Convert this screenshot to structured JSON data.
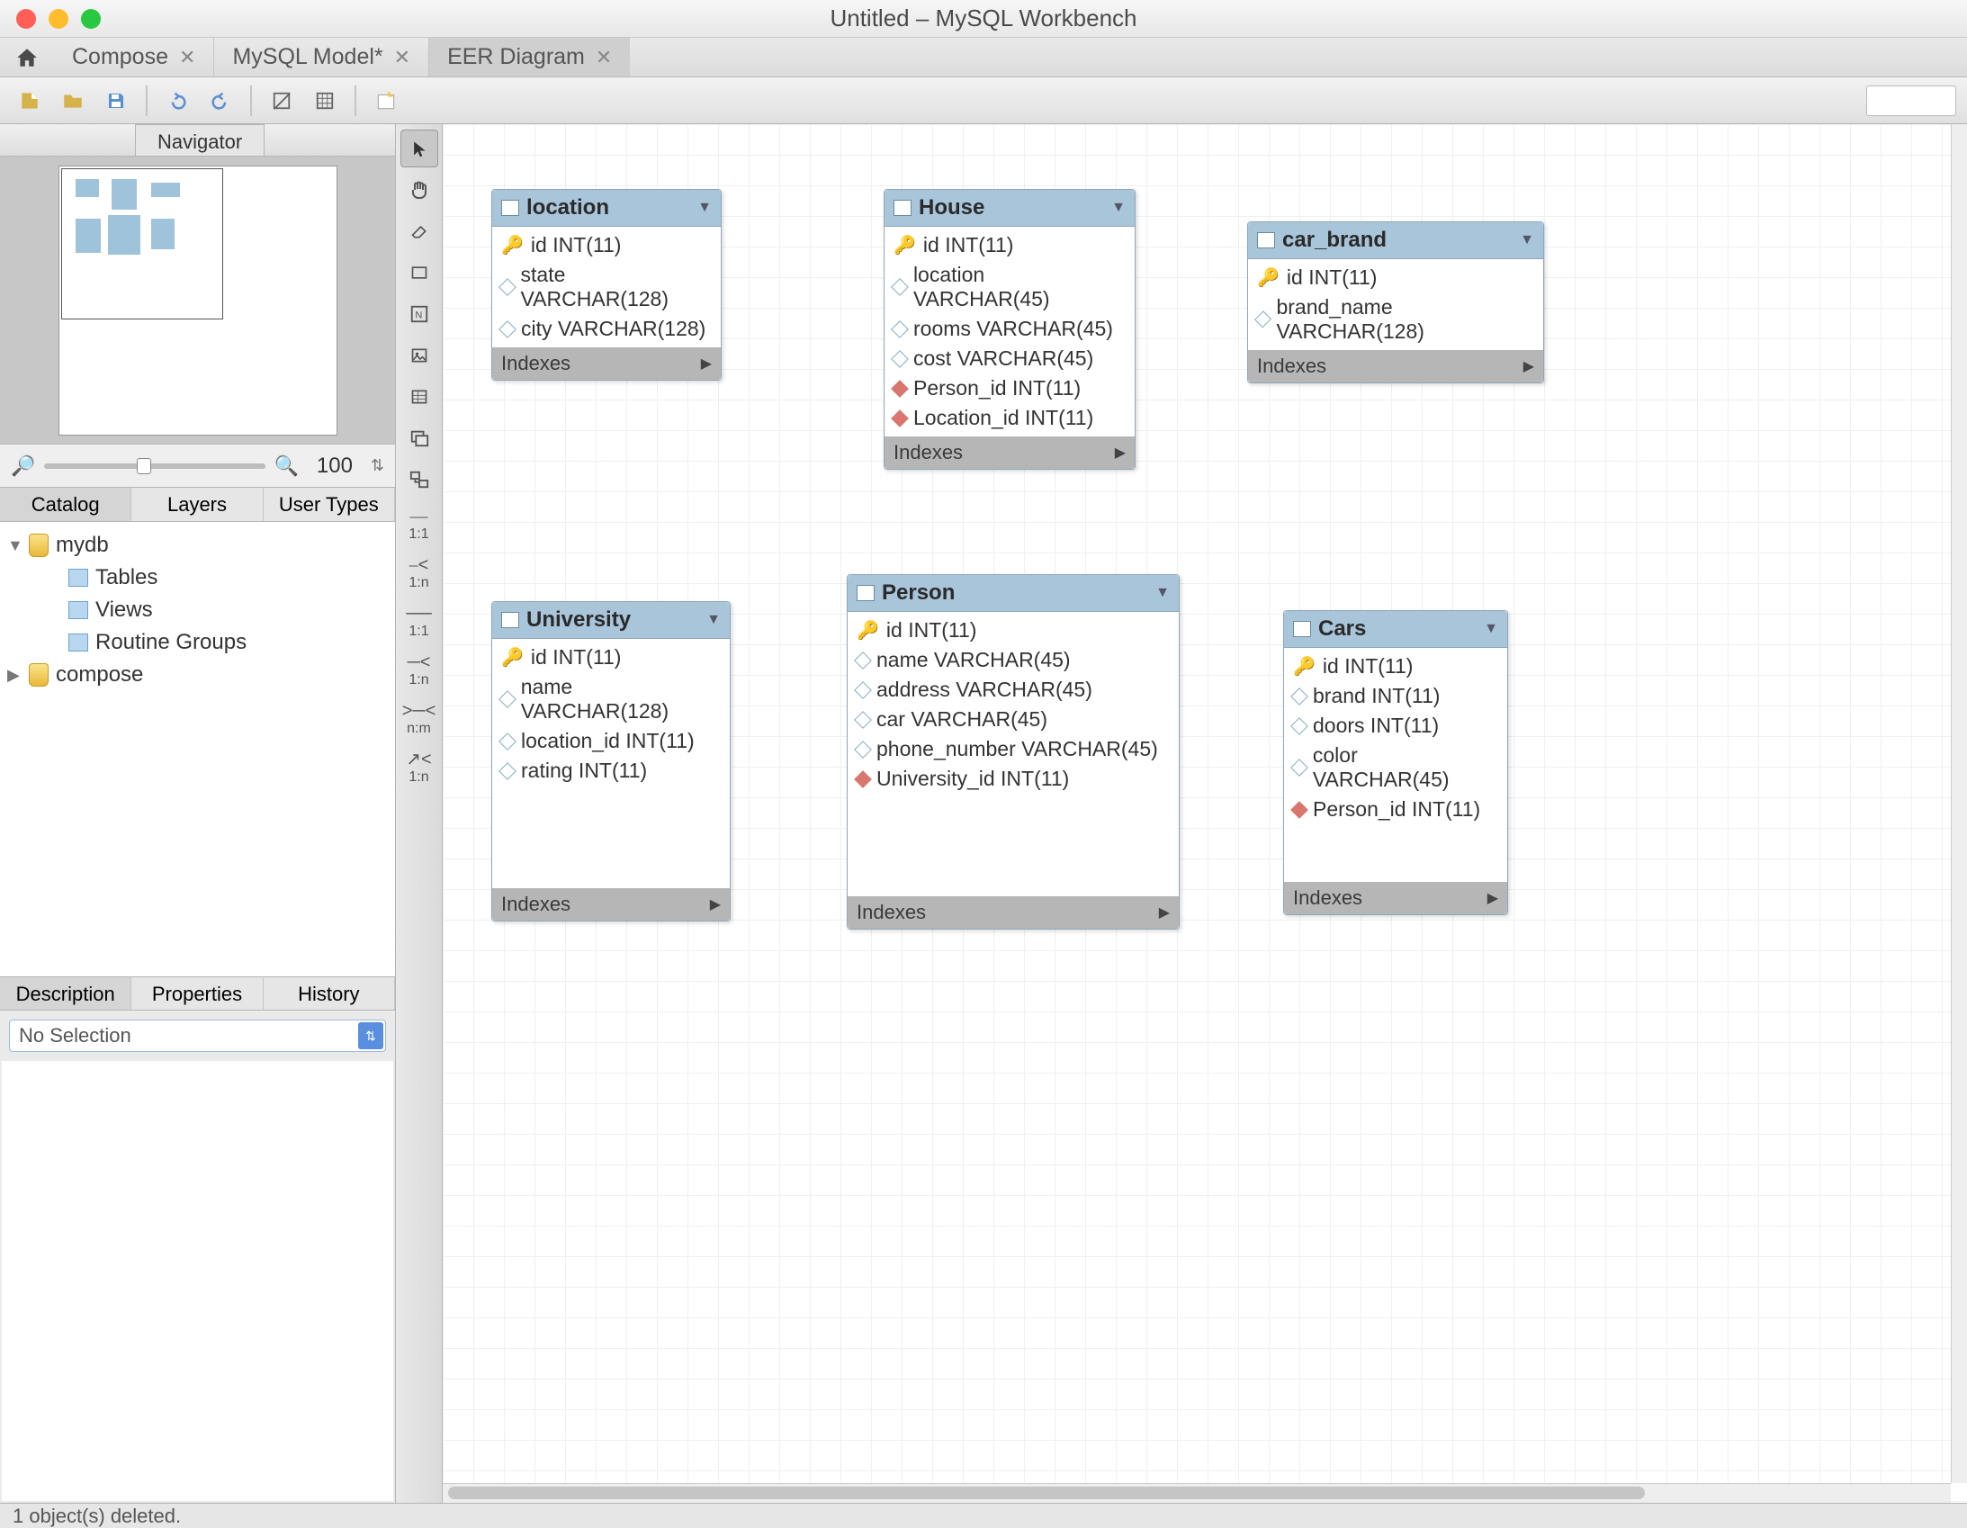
{
  "window": {
    "title": "Untitled – MySQL Workbench"
  },
  "tabs": [
    {
      "label": "Compose",
      "closable": true,
      "active": false
    },
    {
      "label": "MySQL Model*",
      "closable": true,
      "active": false
    },
    {
      "label": "EER Diagram",
      "closable": true,
      "active": true
    }
  ],
  "zoom": {
    "value": "100"
  },
  "navigator_tab": "Navigator",
  "side_tabs": {
    "items": [
      "Catalog",
      "Layers",
      "User Types"
    ],
    "active": 0
  },
  "tree": {
    "dbs": [
      {
        "name": "mydb",
        "expanded": true,
        "children": [
          "Tables",
          "Views",
          "Routine Groups"
        ]
      },
      {
        "name": "compose",
        "expanded": false,
        "children": []
      }
    ]
  },
  "bottom_tabs": {
    "items": [
      "Description",
      "Properties",
      "History"
    ],
    "active": 0
  },
  "selection_dd": "No Selection",
  "palette_labels": {
    "r11s": "1:1",
    "r1ns": "1:n",
    "r11i": "1:1",
    "r1ni": "1:n",
    "rnm": "n:m",
    "r1nfk": "1:n"
  },
  "entities": {
    "location": {
      "name": "location",
      "cols": [
        {
          "icon": "pk",
          "text": "id INT(11)"
        },
        {
          "icon": "col",
          "text": "state VARCHAR(128)"
        },
        {
          "icon": "col",
          "text": "city VARCHAR(128)"
        }
      ],
      "idx": "Indexes"
    },
    "house": {
      "name": "House",
      "cols": [
        {
          "icon": "pk",
          "text": "id INT(11)"
        },
        {
          "icon": "col",
          "text": "location VARCHAR(45)"
        },
        {
          "icon": "col",
          "text": "rooms VARCHAR(45)"
        },
        {
          "icon": "col",
          "text": "cost VARCHAR(45)"
        },
        {
          "icon": "fk",
          "text": "Person_id INT(11)"
        },
        {
          "icon": "fk",
          "text": "Location_id INT(11)"
        }
      ],
      "idx": "Indexes"
    },
    "car_brand": {
      "name": "car_brand",
      "cols": [
        {
          "icon": "pk",
          "text": "id INT(11)"
        },
        {
          "icon": "col",
          "text": "brand_name VARCHAR(128)"
        }
      ],
      "idx": "Indexes"
    },
    "university": {
      "name": "University",
      "cols": [
        {
          "icon": "pk",
          "text": "id INT(11)"
        },
        {
          "icon": "col",
          "text": "name VARCHAR(128)"
        },
        {
          "icon": "col",
          "text": "location_id INT(11)"
        },
        {
          "icon": "col",
          "text": "rating INT(11)"
        }
      ],
      "idx": "Indexes"
    },
    "person": {
      "name": "Person",
      "cols": [
        {
          "icon": "pk",
          "text": "id INT(11)"
        },
        {
          "icon": "col",
          "text": "name VARCHAR(45)"
        },
        {
          "icon": "col",
          "text": "address VARCHAR(45)"
        },
        {
          "icon": "col",
          "text": "car VARCHAR(45)"
        },
        {
          "icon": "col",
          "text": "phone_number VARCHAR(45)"
        },
        {
          "icon": "fk",
          "text": "University_id INT(11)"
        }
      ],
      "idx": "Indexes"
    },
    "cars": {
      "name": "Cars",
      "cols": [
        {
          "icon": "pk",
          "text": "id INT(11)"
        },
        {
          "icon": "col",
          "text": "brand INT(11)"
        },
        {
          "icon": "col",
          "text": "doors INT(11)"
        },
        {
          "icon": "col",
          "text": "color VARCHAR(45)"
        },
        {
          "icon": "fk",
          "text": "Person_id INT(11)"
        }
      ],
      "idx": "Indexes"
    }
  },
  "status": "1 object(s) deleted."
}
